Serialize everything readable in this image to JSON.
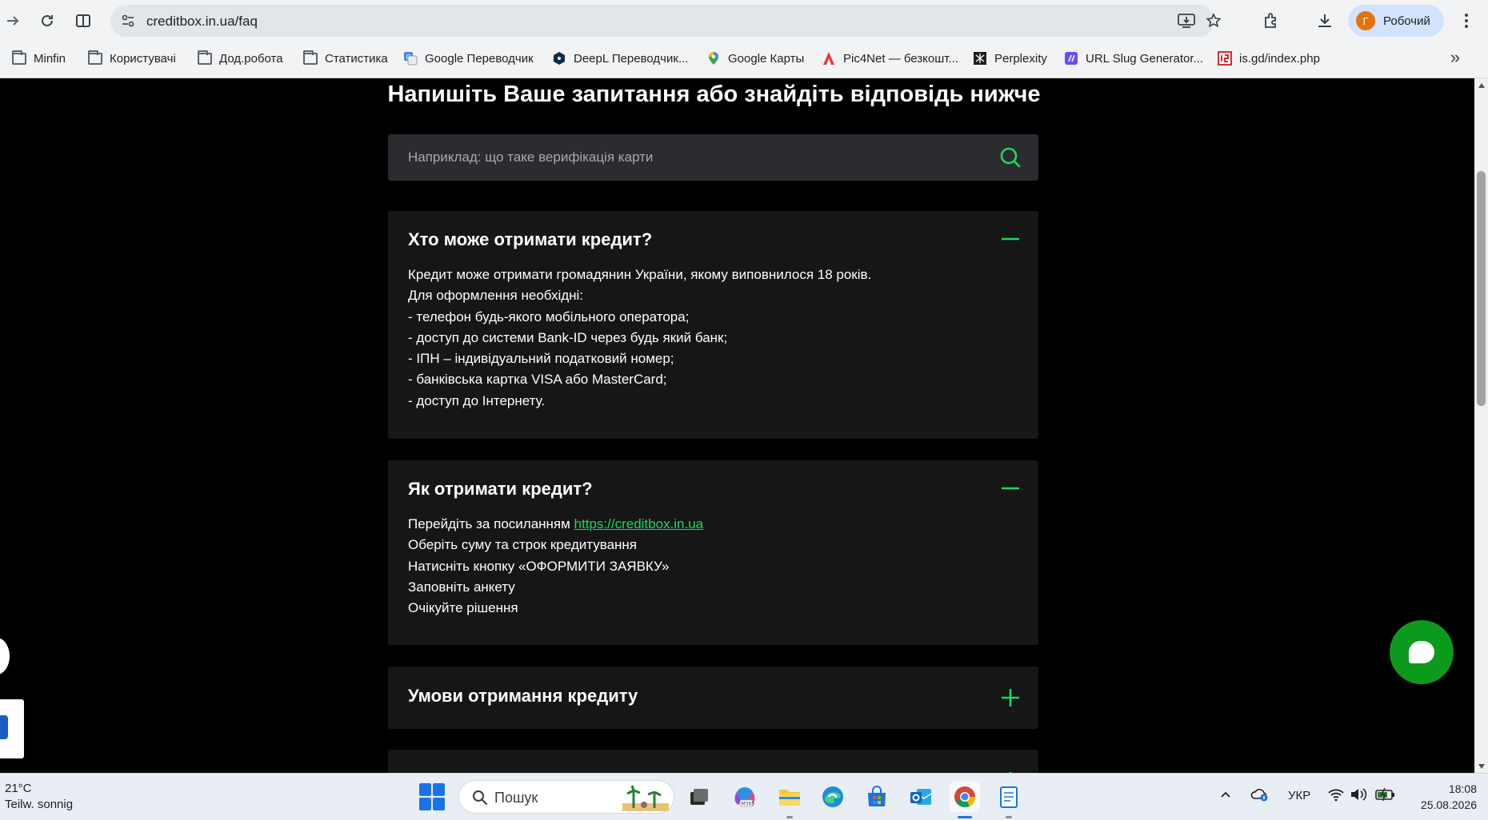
{
  "browser": {
    "url": "creditbox.in.ua/faq",
    "profile_initial": "Г",
    "profile_name": "Робочий",
    "bookmarks": [
      {
        "label": "Minfin",
        "icon": "folder-icon"
      },
      {
        "label": "Користувачі",
        "icon": "folder-icon"
      },
      {
        "label": "Дод.робота",
        "icon": "folder-icon"
      },
      {
        "label": "Статистика",
        "icon": "folder-icon"
      },
      {
        "label": "Google Переводчик",
        "icon": "google-translate-icon"
      },
      {
        "label": "DeepL Переводчик...",
        "icon": "deepl-icon"
      },
      {
        "label": "Google Карты",
        "icon": "google-maps-icon"
      },
      {
        "label": "Pic4Net — безкошт...",
        "icon": "pic4net-icon"
      },
      {
        "label": "Perplexity",
        "icon": "perplexity-icon"
      },
      {
        "label": "URL Slug Generator...",
        "icon": "url-slug-icon"
      },
      {
        "label": "is.gd/index.php",
        "icon": "isgd-icon"
      }
    ],
    "bookmarks_more": "»"
  },
  "page": {
    "heading": "Напишіть Ваше запитання або знайдіть відповідь нижче",
    "search_placeholder": "Наприклад: що таке верифікація карти",
    "faqs": [
      {
        "question": "Хто може отримати кредит?",
        "expanded": true,
        "answer_lines": [
          "Кредит може отримати громадянин України, якому виповнилося 18 років.",
          "Для оформлення необхідні:",
          "- телефон будь-якого мобільного оператора;",
          "- доступ до системи Bank-ID через будь який банк;",
          "- ІПН – індивідуальний податковий номер;",
          "- банківська картка VISA або MasterCard;",
          "- доступ до Інтернету."
        ]
      },
      {
        "question": "Як отримати кредит?",
        "expanded": true,
        "answer_lead": "Перейдіть за посиланням ",
        "answer_link": "https://creditbox.in.ua",
        "answer_lines": [
          "Оберіть суму та строк кредитування",
          "Натисніть кнопку «ОФОРМИТИ ЗАЯВКУ»",
          "Заповніть анкету",
          "Очікуйте рішення"
        ]
      },
      {
        "question": "Умови отримання кредиту",
        "expanded": false
      }
    ],
    "accent_color": "#1ed760"
  },
  "taskbar": {
    "weather_temp": "21°C",
    "weather_desc": "Teilw. sonnig",
    "search_label": "Пошук",
    "lang": "УКР",
    "time": "18:08",
    "date": "25.08.2026"
  }
}
